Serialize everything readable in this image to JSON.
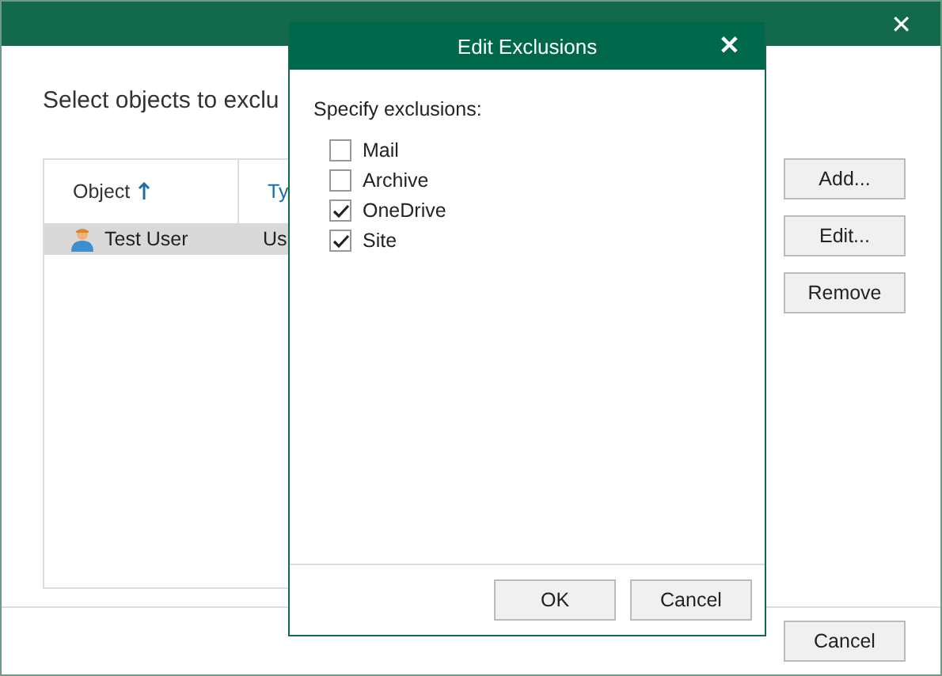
{
  "background_window": {
    "heading": "Select objects to exclu",
    "table": {
      "columns": [
        {
          "label": "Object",
          "sorted": true
        },
        {
          "label": "Ty",
          "sorted": false
        }
      ],
      "rows": [
        {
          "cells": [
            "Test User",
            "Us"
          ],
          "selected": true
        }
      ]
    },
    "side_buttons": [
      "Add...",
      "Edit...",
      "Remove"
    ],
    "footer_buttons": [
      "Cancel"
    ]
  },
  "dialog": {
    "title": "Edit Exclusions",
    "close": "✕",
    "prompt": "Specify exclusions:",
    "options": [
      {
        "label": "Mail",
        "checked": false
      },
      {
        "label": "Archive",
        "checked": false
      },
      {
        "label": "OneDrive",
        "checked": true
      },
      {
        "label": "Site",
        "checked": true
      }
    ],
    "buttons": [
      "OK",
      "Cancel"
    ]
  },
  "window_close": "✕"
}
